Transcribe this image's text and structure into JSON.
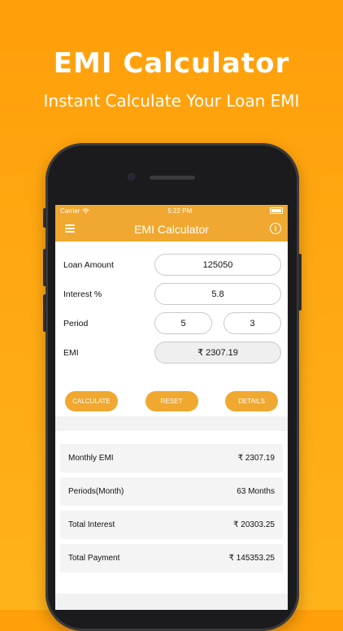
{
  "promo": {
    "title": "EMI Calculator",
    "subtitle": "Instant Calculate Your Loan EMI"
  },
  "status_bar": {
    "carrier": "Carrier",
    "time": "5:22 PM"
  },
  "nav": {
    "title": "EMI Calculator",
    "menu_icon": "hamburger-menu-icon",
    "info_icon": "info-icon"
  },
  "form": {
    "loan_amount_label": "Loan Amount",
    "loan_amount_value": "125050",
    "interest_label": "Interest %",
    "interest_value": "5.8",
    "period_label": "Period",
    "period_years": "5",
    "period_months": "3",
    "emi_label": "EMI",
    "emi_value": "₹ 2307.19"
  },
  "actions": {
    "calculate": "CALCULATE",
    "reset": "RESET",
    "details": "DETAILS"
  },
  "results": [
    {
      "label": "Monthly EMI",
      "value": "₹ 2307.19"
    },
    {
      "label": "Periods(Month)",
      "value": "63 Months"
    },
    {
      "label": "Total Interest",
      "value": "₹ 20303.25"
    },
    {
      "label": "Total Payment",
      "value": "₹ 145353.25"
    }
  ],
  "colors": {
    "accent": "#f0a830",
    "background": "#ffaa14"
  }
}
